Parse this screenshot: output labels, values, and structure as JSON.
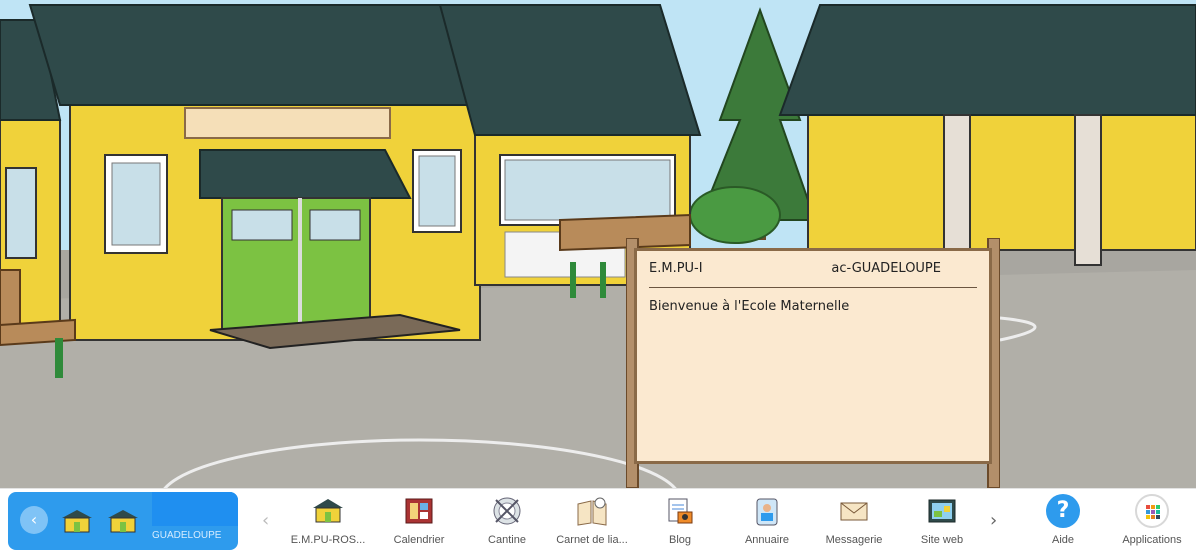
{
  "board": {
    "left_title": "E.M.PU-I",
    "right_title": "ac-GUADELOUPE",
    "message": "Bienvenue à l'Ecole Maternelle"
  },
  "current_school": {
    "label": "GUADELOUPE",
    "back_icon": "chevron-left-icon"
  },
  "apps": [
    {
      "label": "E.M.PU-ROS...",
      "icon": "school-icon"
    },
    {
      "label": "Calendrier",
      "icon": "calendar-icon"
    },
    {
      "label": "Cantine",
      "icon": "cantine-icon"
    },
    {
      "label": "Carnet de lia...",
      "icon": "notebook-icon"
    },
    {
      "label": "Blog",
      "icon": "blog-icon"
    },
    {
      "label": "Annuaire",
      "icon": "directory-icon"
    },
    {
      "label": "Messagerie",
      "icon": "mail-icon"
    },
    {
      "label": "Site web",
      "icon": "website-icon"
    }
  ],
  "help": {
    "label": "Aide",
    "glyph": "?"
  },
  "applications": {
    "label": "Applications"
  },
  "nav": {
    "prev": "‹",
    "next": "›"
  },
  "colors": {
    "accent": "#2e9bed",
    "wall": "#f0d23a",
    "roof": "#2f4a4a",
    "door": "#7cc242",
    "board": "#fbe9d0"
  }
}
